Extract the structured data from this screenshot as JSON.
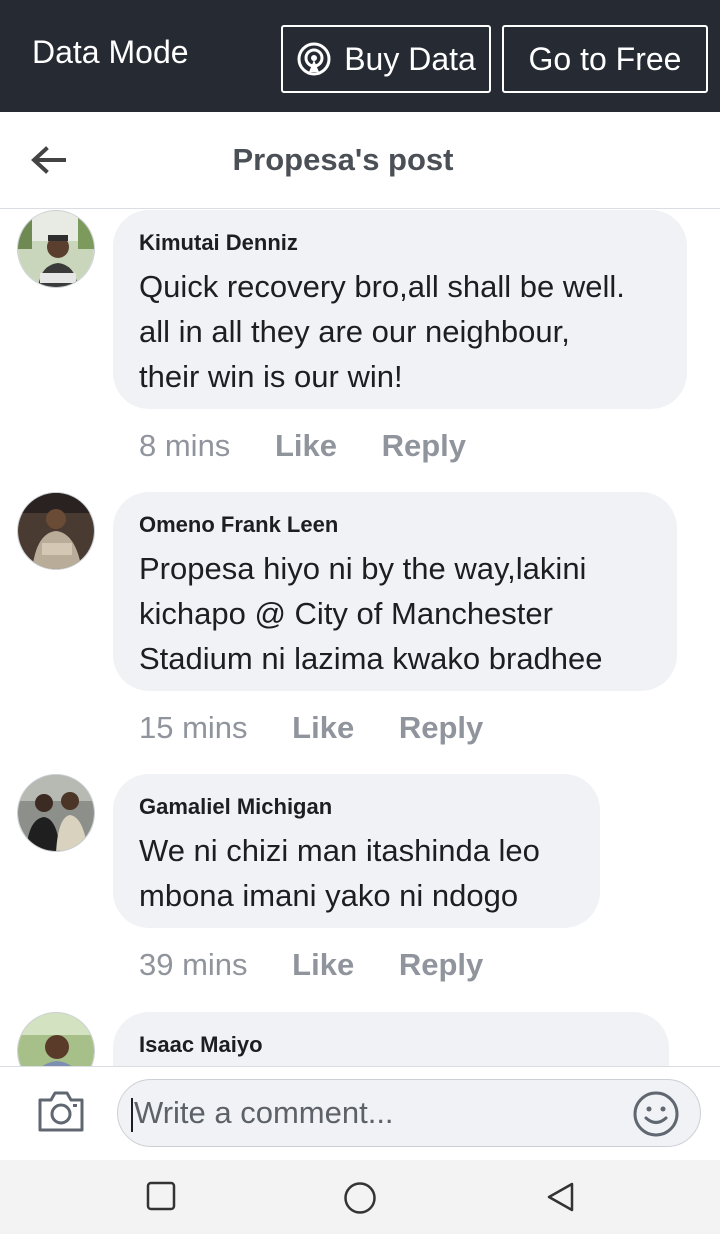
{
  "databar": {
    "mode_label": "Data Mode",
    "buy_label": "Buy Data",
    "free_label": "Go to Free"
  },
  "header": {
    "title": "Propesa's post"
  },
  "comments": [
    {
      "author": "Kimutai Denniz",
      "lines": [
        "Quick recovery bro,all shall be well.",
        "all in all they are our neighbour,",
        "their win is our win!"
      ],
      "time": "8 mins",
      "like": "Like",
      "reply": "Reply"
    },
    {
      "author": "Omeno Frank Leen",
      "lines": [
        "Propesa hiyo ni by the way,lakini",
        "kichapo @ City of Manchester",
        "Stadium ni lazima kwako bradhee"
      ],
      "time": "15 mins",
      "like": "Like",
      "reply": "Reply"
    },
    {
      "author": "Gamaliel Michigan",
      "lines": [
        "We ni chizi man itashinda leo",
        "mbona imani yako ni ndogo"
      ],
      "time": "39 mins",
      "like": "Like",
      "reply": "Reply"
    },
    {
      "author": "Isaac Maiyo"
    }
  ],
  "composer": {
    "placeholder": "Write a comment..."
  },
  "icons": {
    "back": "arrow-left-icon",
    "buy": "broadcast-icon",
    "camera": "camera-icon",
    "emoji": "smiley-icon",
    "nav_recent": "square-icon",
    "nav_home": "circle-icon",
    "nav_back": "triangle-icon"
  },
  "colors": {
    "databar_bg": "#252a33",
    "bubble_bg": "#f0f2f5",
    "meta_text": "#90949c",
    "title_text": "#4b4f56"
  }
}
